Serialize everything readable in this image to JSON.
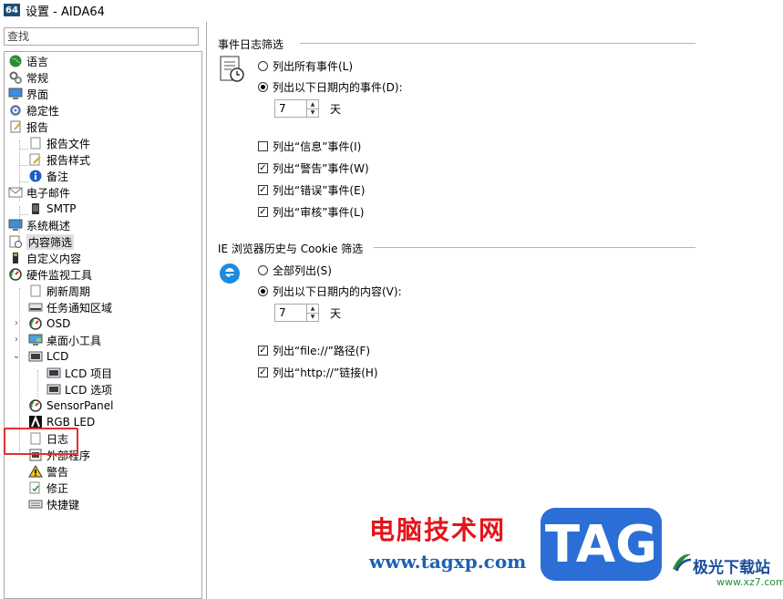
{
  "window": {
    "logo": "64",
    "title": "设置 - AIDA64"
  },
  "sidebar": {
    "search_placeholder": "查找",
    "items": [
      {
        "label": "语言",
        "icon": "globe-icon"
      },
      {
        "label": "常规",
        "icon": "gears-icon"
      },
      {
        "label": "界面",
        "icon": "monitor-icon"
      },
      {
        "label": "稳定性",
        "icon": "gear-icon"
      },
      {
        "label": "报告",
        "icon": "report-icon"
      },
      {
        "label": "报告文件",
        "icon": "file-icon"
      },
      {
        "label": "报告样式",
        "icon": "pencil-file-icon"
      },
      {
        "label": "备注",
        "icon": "info-icon"
      },
      {
        "label": "电子邮件",
        "icon": "envelope-icon"
      },
      {
        "label": "SMTP",
        "icon": "phone-icon"
      },
      {
        "label": "系统概述",
        "icon": "monitor-icon"
      },
      {
        "label": "内容筛选",
        "icon": "filter-log-icon"
      },
      {
        "label": "自定义内容",
        "icon": "usb-icon"
      },
      {
        "label": "硬件监视工具",
        "icon": "gauge-icon"
      },
      {
        "label": "刷新周期",
        "icon": "file-icon"
      },
      {
        "label": "任务通知区域",
        "icon": "taskbar-icon"
      },
      {
        "label": "OSD",
        "icon": "gauge-icon"
      },
      {
        "label": "桌面小工具",
        "icon": "desktop-icon"
      },
      {
        "label": "LCD",
        "icon": "lcd-icon"
      },
      {
        "label": "LCD 项目",
        "icon": "lcd-icon"
      },
      {
        "label": "LCD 选项",
        "icon": "lcd-icon"
      },
      {
        "label": "SensorPanel",
        "icon": "gauge-icon"
      },
      {
        "label": "RGB LED",
        "icon": "rgb-led-icon"
      },
      {
        "label": "日志",
        "icon": "file-icon"
      },
      {
        "label": "外部程序",
        "icon": "program-icon"
      },
      {
        "label": "警告",
        "icon": "warning-icon"
      },
      {
        "label": "修正",
        "icon": "correction-icon"
      },
      {
        "label": "快捷键",
        "icon": "keyboard-icon"
      }
    ]
  },
  "event_log_filter": {
    "title": "事件日志筛选",
    "list_all": "列出所有事件(L)",
    "list_recent": "列出以下日期内的事件(D):",
    "days_value": "7",
    "days_unit": "天",
    "info_events": "列出“信息”事件(I)",
    "warning_events": "列出“警告”事件(W)",
    "error_events": "列出“错误”事件(E)",
    "audit_events": "列出“审核”事件(L)"
  },
  "ie_history_filter": {
    "title": "IE 浏览器历史与 Cookie 筛选",
    "list_all": "全部列出(S)",
    "list_recent": "列出以下日期内的内容(V):",
    "days_value": "7",
    "days_unit": "天",
    "file_paths": "列出“file://”路径(F)",
    "http_links": "列出“http://”链接(H)"
  },
  "watermark": {
    "site_cn": "电脑技术网",
    "site_url": "www.tagxp.com",
    "tag": "TAG",
    "brand_cn": "极光下载站",
    "brand_url": "www.xz7.com"
  },
  "colors": {
    "highlight": "#e03030",
    "tag_bg": "#2b6fd6",
    "watermark_red": "#e4141b"
  }
}
